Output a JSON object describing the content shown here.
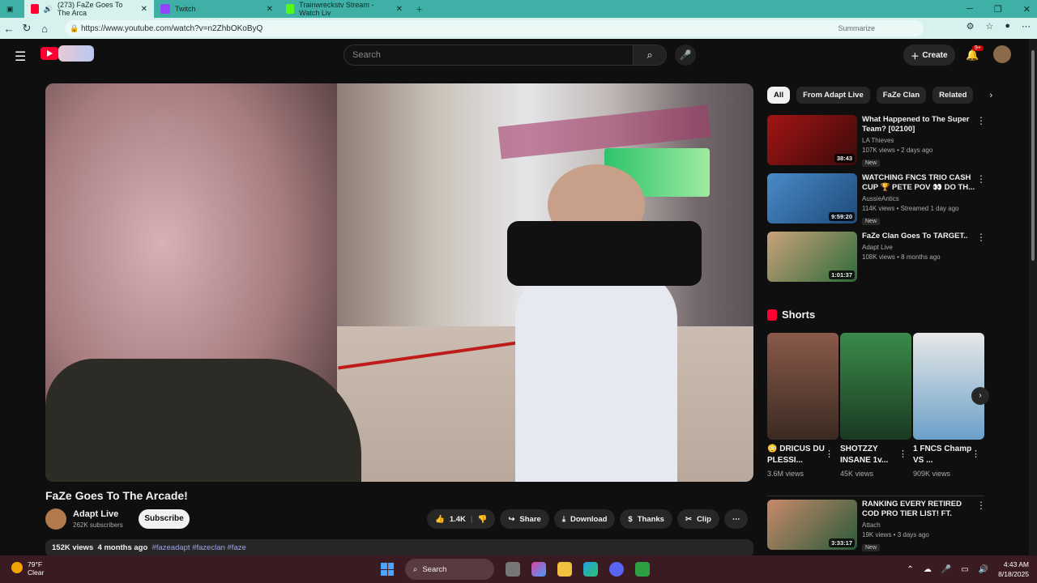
{
  "browser": {
    "tabs": [
      {
        "title": "(273) FaZe Goes To The Arca",
        "active": true
      },
      {
        "title": "Twitch",
        "active": false
      },
      {
        "title": "Trainwreckstv Stream - Watch Liv",
        "active": false
      }
    ],
    "url": "https://www.youtube.com/watch?v=n2ZhbOKoByQ",
    "summarize_label": "Summarize"
  },
  "header": {
    "search_placeholder": "Search",
    "create_label": "Create",
    "notif_count": "9+"
  },
  "video": {
    "title": "FaZe Goes To The Arcade!",
    "channel": "Adapt Live",
    "subscribers": "262K subscribers",
    "subscribe_label": "Subscribe",
    "likes": "1.4K",
    "share_label": "Share",
    "download_label": "Download",
    "thanks_label": "Thanks",
    "clip_label": "Clip",
    "views": "152K views",
    "age": "4 months ago",
    "tags": "#fazeadapt #fazeclan #faze"
  },
  "chips": [
    "All",
    "From Adapt Live",
    "FaZe Clan",
    "Related"
  ],
  "recommendations": [
    {
      "title": "What Happened to The Super Team? [02100]",
      "channel": "LA Thieves",
      "meta": "107K views • 2 days ago",
      "badge": "New",
      "duration": "38:43",
      "thumb_color": "#7a1010"
    },
    {
      "title": "WATCHING FNCS TRIO CASH CUP 🏆 PETE POV 👀 DO TH...",
      "channel": "AussieAntics",
      "meta": "114K views • Streamed 1 day ago",
      "badge": "New",
      "duration": "9:59:20",
      "thumb_color": "#3d7ab8"
    },
    {
      "title": "FaZe Clan Goes To TARGET..",
      "channel": "Adapt Live",
      "meta": "108K views • 8 months ago",
      "badge": "",
      "duration": "1:01:37",
      "thumb_color": "#2e6b3a"
    },
    {
      "title": "RANKING EVERY RETIRED COD PRO TIER LIST! FT. KARMA, ...",
      "channel": "Attach",
      "meta": "19K views • 3 days ago",
      "badge": "New",
      "duration": "3:33:17",
      "thumb_color": "#3a7a4a"
    }
  ],
  "shorts": {
    "heading": "Shorts",
    "items": [
      {
        "title": "😳 DRICUS DU PLESSI...",
        "views": "3.6M views",
        "color": "#5a3a30"
      },
      {
        "title": "SHOTZZY INSANE 1v...",
        "views": "45K views",
        "color": "#2e6a3a"
      },
      {
        "title": "1 FNCS Champ VS ...",
        "views": "909K views",
        "color": "#7aa0b8"
      }
    ]
  },
  "taskbar": {
    "temp": "79°F",
    "weather": "Clear",
    "search_label": "Search",
    "time": "4:43 AM",
    "date": "8/18/2025"
  }
}
